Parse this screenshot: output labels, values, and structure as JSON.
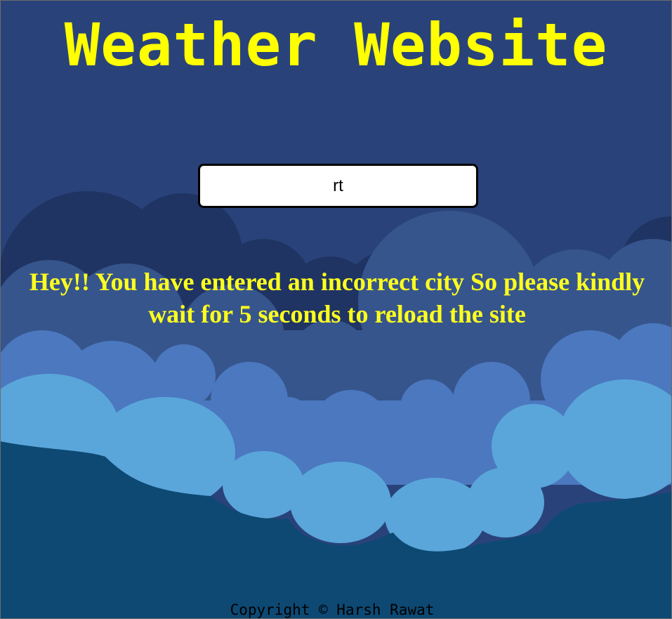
{
  "header": {
    "title": "Weather Website"
  },
  "search": {
    "value": "rt",
    "placeholder": ""
  },
  "message": {
    "error_text": "Hey!! You have entered an incorrect city So please kindly wait for 5 seconds to reload the site"
  },
  "footer": {
    "copyright": "Copyright © Harsh Rawat"
  },
  "colors": {
    "sky": "#29437a",
    "dark_cloud": "#1f3463",
    "mid_cloud": "#36558c",
    "blue_cloud": "#4b78bf",
    "light_cloud": "#5aa6db",
    "ground": "#0d4973",
    "title": "#ffff00",
    "message": "#ffff1e"
  }
}
